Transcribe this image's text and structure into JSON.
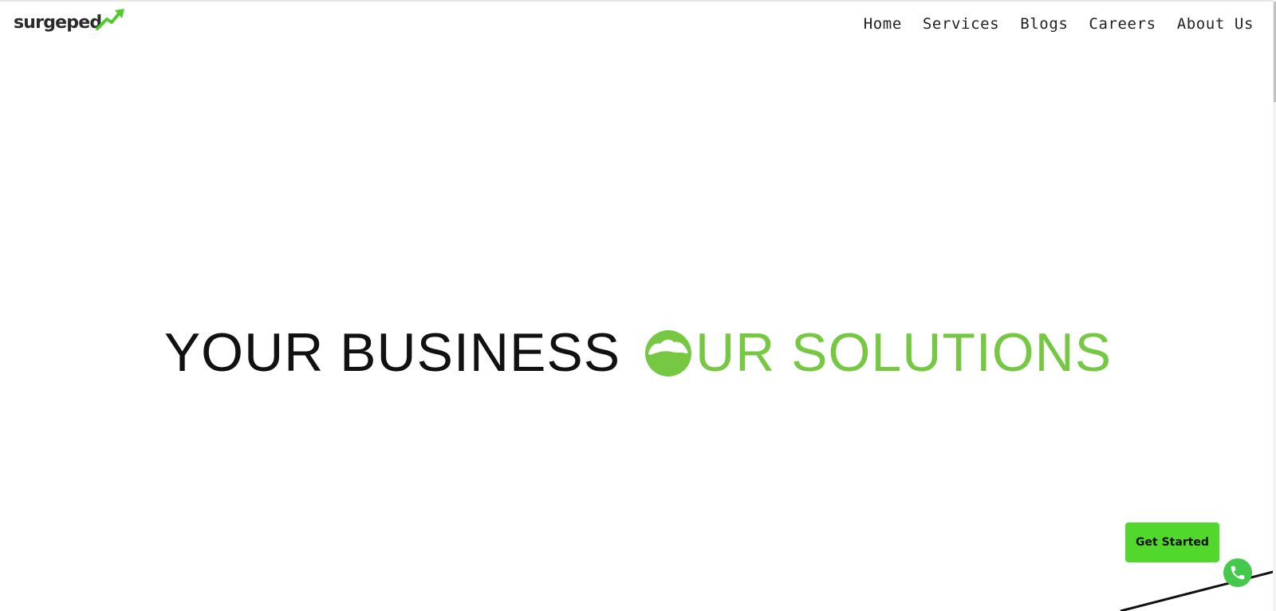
{
  "brand": {
    "logo_text": "surgeped",
    "accent_color": "#76c843",
    "button_color": "#52d82c"
  },
  "nav": {
    "items": [
      {
        "label": "Home"
      },
      {
        "label": "Services"
      },
      {
        "label": "Blogs"
      },
      {
        "label": "Careers"
      },
      {
        "label": "About Us"
      }
    ]
  },
  "hero": {
    "part1": "YOUR BUSINESS",
    "part2": "UR SOLUTIONS"
  },
  "cta": {
    "get_started_label": "Get Started"
  },
  "icons": {
    "logo_arrow": "arrow-up-right-icon",
    "phone": "phone-icon",
    "hero_o": "globe-o-icon"
  }
}
